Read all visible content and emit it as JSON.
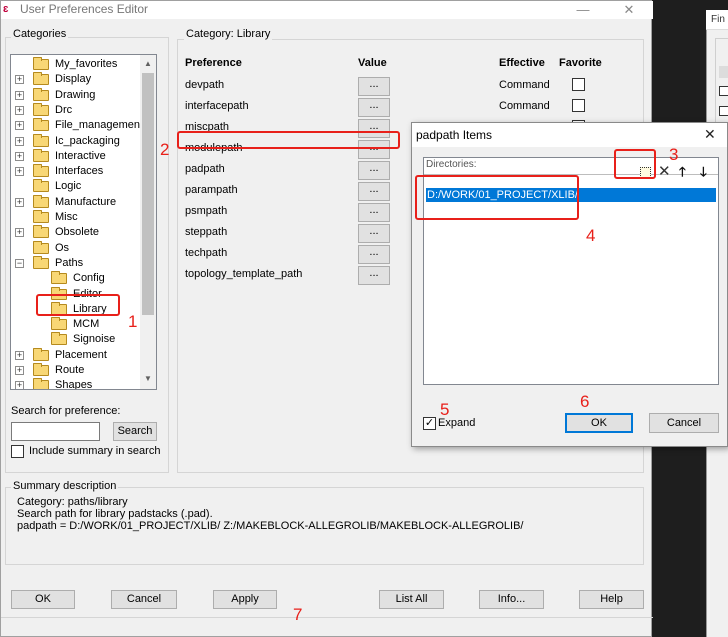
{
  "main_window": {
    "title": "User Preferences Editor",
    "app_icon_text": "ɛ",
    "minimize_glyph": "—",
    "close_glyph": "✕"
  },
  "background_window": {
    "title": "Fin"
  },
  "categories": {
    "label": "Categories",
    "items": [
      {
        "label": "My_favorites",
        "level": 0,
        "expander": ""
      },
      {
        "label": "Display",
        "level": 0,
        "expander": "+"
      },
      {
        "label": "Drawing",
        "level": 0,
        "expander": "+"
      },
      {
        "label": "Drc",
        "level": 0,
        "expander": "+"
      },
      {
        "label": "File_management",
        "level": 0,
        "expander": "+"
      },
      {
        "label": "Ic_packaging",
        "level": 0,
        "expander": "+"
      },
      {
        "label": "Interactive",
        "level": 0,
        "expander": "+"
      },
      {
        "label": "Interfaces",
        "level": 0,
        "expander": "+"
      },
      {
        "label": "Logic",
        "level": 0,
        "expander": ""
      },
      {
        "label": "Manufacture",
        "level": 0,
        "expander": "+"
      },
      {
        "label": "Misc",
        "level": 0,
        "expander": ""
      },
      {
        "label": "Obsolete",
        "level": 0,
        "expander": "+"
      },
      {
        "label": "Os",
        "level": 0,
        "expander": ""
      },
      {
        "label": "Paths",
        "level": 0,
        "expander": "−"
      },
      {
        "label": "Config",
        "level": 1,
        "expander": ""
      },
      {
        "label": "Editor",
        "level": 1,
        "expander": ""
      },
      {
        "label": "Library",
        "level": 1,
        "expander": ""
      },
      {
        "label": "MCM",
        "level": 1,
        "expander": ""
      },
      {
        "label": "Signoise",
        "level": 1,
        "expander": ""
      },
      {
        "label": "Placement",
        "level": 0,
        "expander": "+"
      },
      {
        "label": "Route",
        "level": 0,
        "expander": "+"
      },
      {
        "label": "Shapes",
        "level": 0,
        "expander": "+"
      }
    ]
  },
  "search": {
    "label": "Search for preference:",
    "value": "",
    "button": "Search",
    "include_summary_label": "Include summary in search",
    "include_summary_checked": false
  },
  "category_panel": {
    "label": "Category:  Library",
    "headers": {
      "preference": "Preference",
      "value": "Value",
      "effective": "Effective",
      "favorite": "Favorite"
    },
    "rows": [
      {
        "preference": "devpath",
        "value": "...",
        "effective": "Command"
      },
      {
        "preference": "interfacepath",
        "value": "...",
        "effective": "Command"
      },
      {
        "preference": "miscpath",
        "value": "...",
        "effective": ""
      },
      {
        "preference": "modulepath",
        "value": "...",
        "effective": ""
      },
      {
        "preference": "padpath",
        "value": "...",
        "effective": ""
      },
      {
        "preference": "parampath",
        "value": "...",
        "effective": ""
      },
      {
        "preference": "psmpath",
        "value": "...",
        "effective": ""
      },
      {
        "preference": "steppath",
        "value": "...",
        "effective": ""
      },
      {
        "preference": "techpath",
        "value": "...",
        "effective": ""
      },
      {
        "preference": "topology_template_path",
        "value": "...",
        "effective": ""
      }
    ]
  },
  "summary": {
    "label": "Summary description",
    "lines": [
      "Category: paths/library",
      "Search path for library padstacks (.pad).",
      "padpath = D:/WORK/01_PROJECT/XLIB/ Z:/MAKEBLOCK-ALLEGROLIB/MAKEBLOCK-ALLEGROLIB/"
    ]
  },
  "bottom_buttons": {
    "ok": "OK",
    "cancel": "Cancel",
    "apply": "Apply",
    "list_all": "List All",
    "info": "Info...",
    "help": "Help"
  },
  "dialog": {
    "title": "padpath Items",
    "close_glyph": "✕",
    "directories_label": "Directories:",
    "entries": [
      "D:/WORK/01_PROJECT/XLIB/"
    ],
    "toolbar": {
      "delete": "✕",
      "up": "🡑",
      "down": "🡓"
    },
    "expand_label": "Expand",
    "expand_checked": true,
    "ok": "OK",
    "cancel": "Cancel"
  },
  "annotations": [
    "1",
    "2",
    "3",
    "4",
    "5",
    "6",
    "7"
  ],
  "colors": {
    "annotation_red": "#e8201a",
    "selection_blue": "#0078d7",
    "folder_yellow": "#f8d775"
  }
}
